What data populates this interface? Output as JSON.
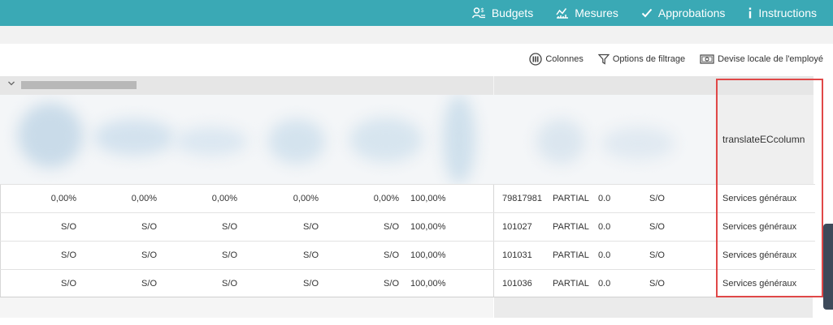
{
  "nav": {
    "items": [
      {
        "label": "Budgets",
        "icon": "user-budget-icon"
      },
      {
        "label": "Mesures",
        "icon": "chart-icon"
      },
      {
        "label": "Approbations",
        "icon": "check-icon"
      },
      {
        "label": "Instructions",
        "icon": "info-icon"
      }
    ]
  },
  "toolbar": {
    "columns_label": "Colonnes",
    "filter_label": "Options de filtrage",
    "currency_label": "Devise locale de l'employé"
  },
  "grid": {
    "column_header": "translateECcolumn",
    "rows": [
      {
        "p1": "0,00%",
        "p2": "0,00%",
        "p3": "0,00%",
        "p4": "0,00%",
        "p5": "0,00%",
        "total": "100,00%",
        "id": "79817981",
        "status": "PARTIAL",
        "value": "0.0",
        "so": "S/O",
        "dept": "Services généraux"
      },
      {
        "p1": "S/O",
        "p2": "S/O",
        "p3": "S/O",
        "p4": "S/O",
        "p5": "S/O",
        "total": "100,00%",
        "id": "101027",
        "status": "PARTIAL",
        "value": "0.0",
        "so": "S/O",
        "dept": "Services généraux"
      },
      {
        "p1": "S/O",
        "p2": "S/O",
        "p3": "S/O",
        "p4": "S/O",
        "p5": "S/O",
        "total": "100,00%",
        "id": "101031",
        "status": "PARTIAL",
        "value": "0.0",
        "so": "S/O",
        "dept": "Services généraux"
      },
      {
        "p1": "S/O",
        "p2": "S/O",
        "p3": "S/O",
        "p4": "S/O",
        "p5": "S/O",
        "total": "100,00%",
        "id": "101036",
        "status": "PARTIAL",
        "value": "0.0",
        "so": "S/O",
        "dept": "Services généraux"
      }
    ]
  },
  "colors": {
    "topbar": "#3aa9b5",
    "highlight": "#e04848"
  }
}
